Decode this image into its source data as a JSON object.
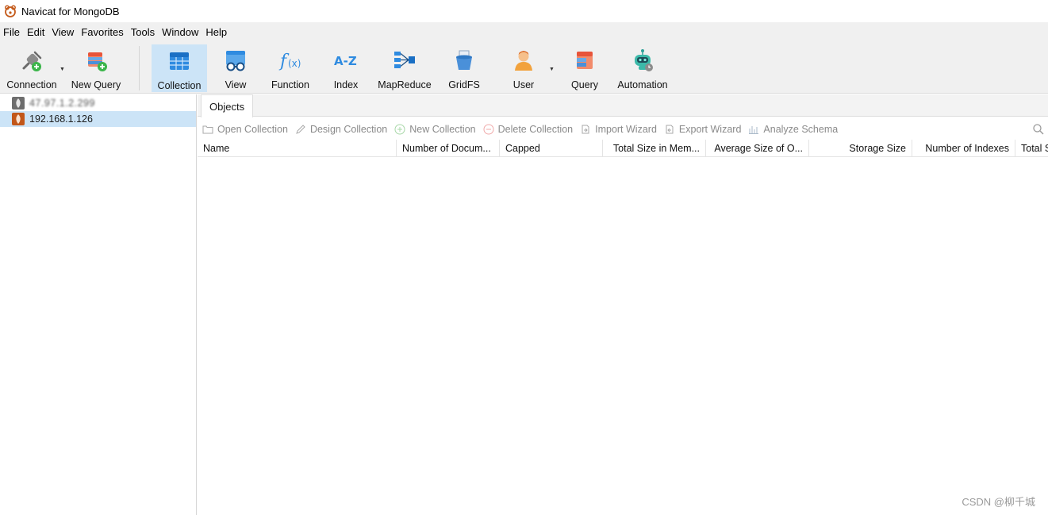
{
  "window": {
    "title": "Navicat for MongoDB"
  },
  "menu": [
    "File",
    "Edit",
    "View",
    "Favorites",
    "Tools",
    "Window",
    "Help"
  ],
  "toolbar": {
    "connection": "Connection",
    "new_query": "New Query",
    "collection": "Collection",
    "view": "View",
    "function": "Function",
    "index": "Index",
    "mapreduce": "MapReduce",
    "gridfs": "GridFS",
    "user": "User",
    "query": "Query",
    "automation": "Automation"
  },
  "connections": [
    {
      "label": "47.97.1.2.299",
      "selected": false
    },
    {
      "label": "192.168.1.126",
      "selected": true
    }
  ],
  "tabs": {
    "objects": "Objects"
  },
  "object_toolbar": {
    "open_collection": "Open Collection",
    "design_collection": "Design Collection",
    "new_collection": "New Collection",
    "delete_collection": "Delete Collection",
    "import_wizard": "Import Wizard",
    "export_wizard": "Export Wizard",
    "analyze_schema": "Analyze Schema"
  },
  "columns": {
    "name": "Name",
    "num_docs": "Number of Docum...",
    "capped": "Capped",
    "total_size_mem": "Total Size in Mem...",
    "avg_size": "Average Size of O...",
    "storage_size": "Storage Size",
    "num_indexes": "Number of Indexes",
    "total": "Total S"
  },
  "watermark": "CSDN @柳千城",
  "colors": {
    "accent": "#cce4f7",
    "selected_tab": "#cce4f7",
    "icon_blue": "#1e88d6",
    "icon_orange": "#e26b2d"
  }
}
